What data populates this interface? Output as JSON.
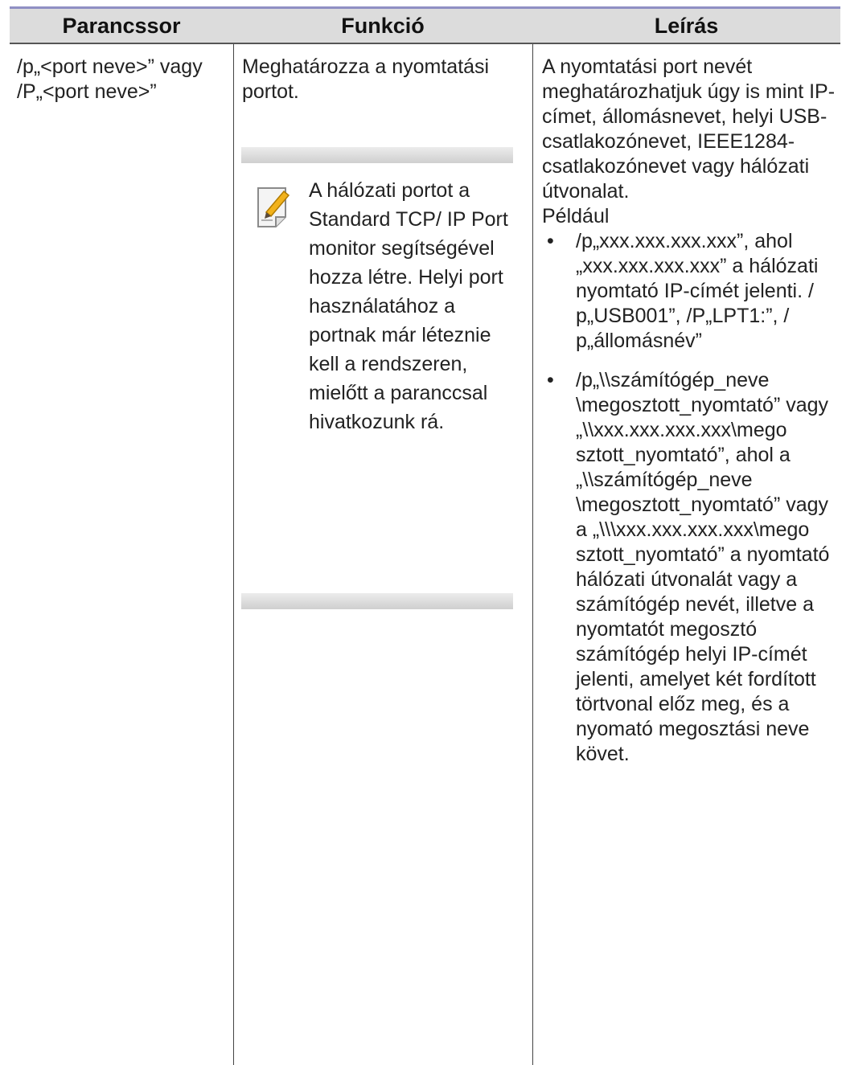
{
  "table": {
    "headers": [
      "Parancssor",
      "Funkció",
      "Leírás"
    ],
    "row": {
      "command": "/p„<port neve>” vagy /P„<port neve>”",
      "function": "Meghatározza a nyomtatási portot.",
      "note": "A hálózati portot a Standard TCP/ IP Port monitor segítségével hozza létre. Helyi port használatához a portnak már léteznie kell a rendszeren, mielőtt a paranccsal hivatkozunk rá.",
      "description": "A nyomtatási port nevét meghatározhatjuk úgy is mint IP-címet, állomásnevet, helyi USB-csatlakozónevet, IEEE1284-csatlakozónevet vagy hálózati útvonalat.",
      "example_label": "Például",
      "bullets": [
        "/p„xxx.xxx.xxx.xxx”, ahol „xxx.xxx.xxx.xxx” a hálózati nyomtató IP-címét jelenti. / p„USB001”, /P„LPT1:”, / p„állomásnév”",
        "/p„\\\\számítógép_neve \\megosztott_nyomtató” vagy „\\\\xxx.xxx.xxx.xxx\\mego sztott_nyomtató”, ahol a „\\\\számítógép_neve \\megosztott_nyomtató” vagy a „\\\\\\xxx.xxx.xxx.xxx\\mego sztott_nyomtató” a nyomtató hálózati útvonalát vagy a számítógép nevét, illetve a nyomtatót megosztó számítógép helyi IP-címét jelenti, amelyet két fordított törtvonal előz meg, és a nyomató megosztási neve követ."
      ],
      "bullet_symbol": "•"
    },
    "note_icon": "note-pencil-icon",
    "header_bg": "#dcdcdc",
    "top_rule_color": "#8f8fc4"
  }
}
